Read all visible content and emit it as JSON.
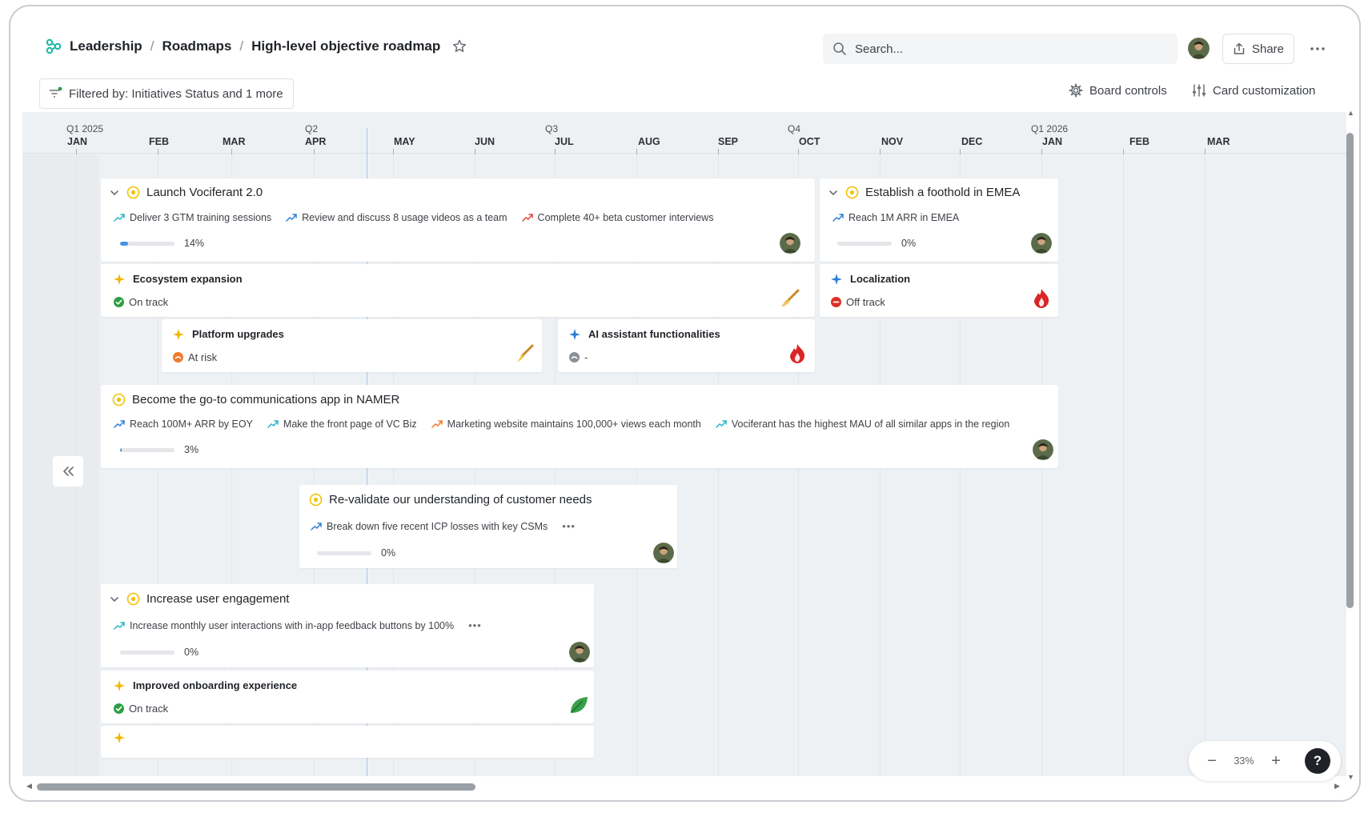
{
  "header": {
    "breadcrumbs": [
      "Leadership",
      "Roadmaps",
      "High-level objective roadmap"
    ],
    "search_placeholder": "Search...",
    "share_label": "Share"
  },
  "toolbar": {
    "filter_label": "Filtered by: Initiatives Status and 1 more",
    "board_controls_label": "Board controls",
    "card_customization_label": "Card customization"
  },
  "timeline": {
    "quarters": [
      "Q1 2025",
      "Q2",
      "Q3",
      "Q4",
      "Q1 2026"
    ],
    "months": [
      "JAN",
      "FEB",
      "MAR",
      "APR",
      "MAY",
      "JUN",
      "JUL",
      "AUG",
      "SEP",
      "OCT",
      "NOV",
      "DEC",
      "JAN",
      "FEB",
      "MAR"
    ]
  },
  "objectives": [
    {
      "title": "Launch Vociferant 2.0",
      "key_results": [
        "Deliver 3 GTM training sessions",
        "Review and discuss 8 usage videos as a team",
        "Complete 40+ beta customer interviews"
      ],
      "progress": "14%",
      "progress_value": 14
    },
    {
      "title": "Establish a foothold in EMEA",
      "key_results": [
        "Reach 1M ARR in EMEA"
      ],
      "progress": "0%",
      "progress_value": 0
    },
    {
      "title": "Become the go-to communications app in NAMER",
      "key_results": [
        "Reach 100M+ ARR by EOY",
        "Make the front page of VC Biz",
        "Marketing website maintains 100,000+ views each month",
        "Vociferant has the highest MAU of all similar apps in the region"
      ],
      "progress": "3%",
      "progress_value": 3
    },
    {
      "title": "Re-validate our understanding of customer needs",
      "key_results": [
        "Break down five recent ICP losses with key CSMs"
      ],
      "progress": "0%",
      "progress_value": 0
    },
    {
      "title": "Increase user engagement",
      "key_results": [
        "Increase monthly user interactions with in-app feedback buttons by 100%"
      ],
      "progress": "0%",
      "progress_value": 0
    }
  ],
  "initiatives": [
    {
      "title": "Ecosystem expansion",
      "status": "On track"
    },
    {
      "title": "Localization",
      "status": "Off track"
    },
    {
      "title": "Platform upgrades",
      "status": "At risk"
    },
    {
      "title": "AI assistant functionalities",
      "status": "-"
    },
    {
      "title": "Improved onboarding experience",
      "status": "On track"
    }
  ],
  "colors": {
    "on_track": "#2e9e44",
    "off_track": "#d93025",
    "at_risk": "#f07a2b",
    "none": "#8b9096",
    "goal": "#f2c200",
    "accent": "#4a90e2"
  },
  "zoom": {
    "value": "33%",
    "minus": "−",
    "plus": "+"
  },
  "help_label": "?"
}
